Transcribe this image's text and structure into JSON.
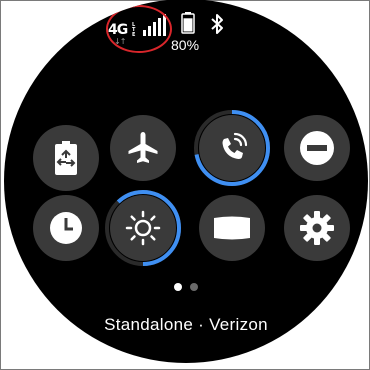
{
  "status_bar": {
    "network": {
      "generation": "4G",
      "sub": "LTE",
      "arrows": "↓↑",
      "icon": "network-4g-lte-icon"
    },
    "signal": {
      "icon": "signal-bars-icon",
      "level_fraction": 1.0
    },
    "battery": {
      "percent_text": "80%",
      "level_fraction": 0.8,
      "icon": "battery-icon"
    },
    "bluetooth": {
      "icon": "bluetooth-icon"
    }
  },
  "annotation": {
    "color": "#d9262b",
    "shape": "circle"
  },
  "quick_settings": {
    "rows": [
      [
        {
          "name": "power-saving",
          "icon": "battery-recycle-icon",
          "active": false
        },
        {
          "name": "airplane-mode",
          "icon": "airplane-icon",
          "active": false
        },
        {
          "name": "sound-mode",
          "icon": "phone-vibrate-icon",
          "active": true,
          "ring_fraction": 0.72
        },
        {
          "name": "do-not-disturb",
          "icon": "minus-circle-icon",
          "active": false
        }
      ],
      [
        {
          "name": "watch-only",
          "icon": "clock-icon",
          "active": false
        },
        {
          "name": "brightness",
          "icon": "sun-icon",
          "active": true,
          "ring_fraction": 0.62
        },
        {
          "name": "always-on-display",
          "icon": "screen-icon",
          "active": false
        },
        {
          "name": "settings",
          "icon": "gear-icon",
          "active": false
        }
      ]
    ]
  },
  "pager": {
    "pages": 2,
    "current": 1
  },
  "footer": {
    "carrier_text": "Standalone · Verizon"
  },
  "colors": {
    "background": "#000000",
    "tile": "#3a3a3a",
    "accent": "#3f8ff2",
    "ring_track": "#2a2a2a",
    "text": "#ffffff"
  }
}
